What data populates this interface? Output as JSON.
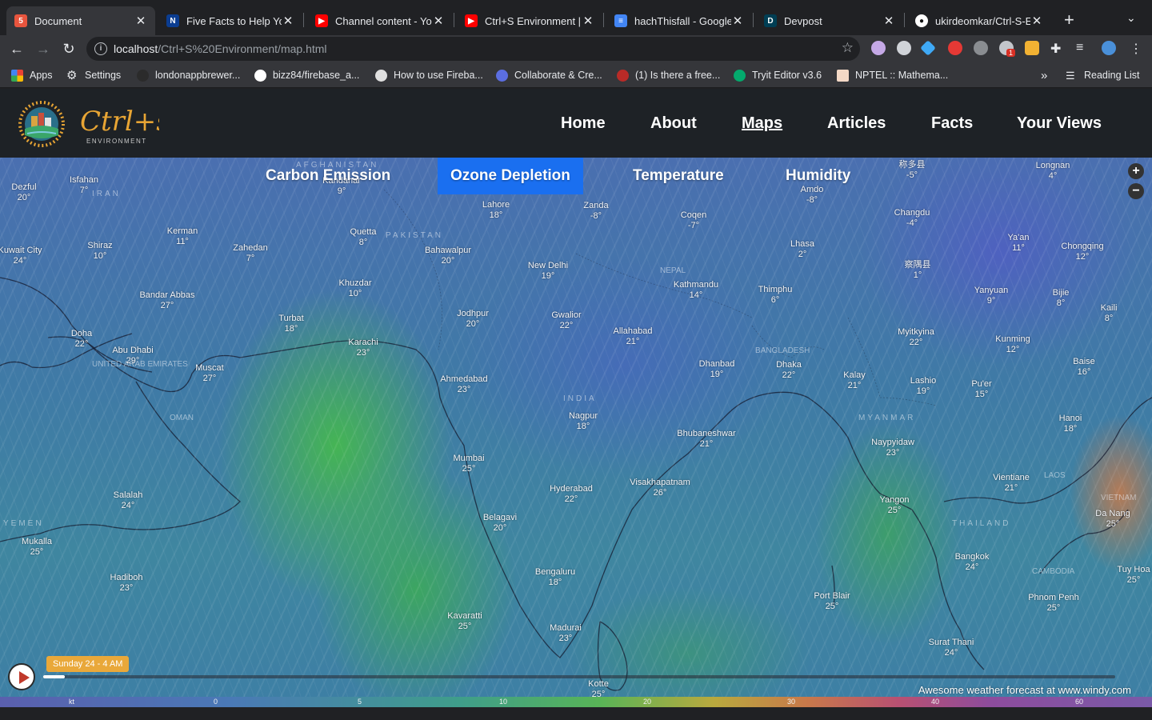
{
  "browser": {
    "tabs": [
      {
        "title": "Document",
        "active": true
      },
      {
        "title": "Five Facts to Help You",
        "active": false
      },
      {
        "title": "Channel content - YouTube",
        "active": false
      },
      {
        "title": "Ctrl+S Environment | YouTube",
        "active": false
      },
      {
        "title": "hachThisfall - Google Docs",
        "active": false
      },
      {
        "title": "Devpost",
        "active": false
      },
      {
        "title": "ukirdeomkar/Ctrl-S-Environment",
        "active": false
      }
    ],
    "new_tab": "+",
    "url_host": "localhost",
    "url_path": "/Ctrl+S%20Environment/map.html",
    "bookmarks": [
      {
        "label": "Apps"
      },
      {
        "label": "Settings"
      },
      {
        "label": "londonappbrewer..."
      },
      {
        "label": "bizz84/firebase_a..."
      },
      {
        "label": "How to use Fireba..."
      },
      {
        "label": "Collaborate & Cre..."
      },
      {
        "label": "(1) Is there a free..."
      },
      {
        "label": "Tryit Editor v3.6"
      },
      {
        "label": "NPTEL :: Mathema..."
      }
    ],
    "more_bookmarks": "»",
    "reading_list": "Reading List",
    "extension_badge": "1"
  },
  "site": {
    "logo_text": "Ctrl+s",
    "logo_subtext": "ENVIRONMENT",
    "nav": [
      "Home",
      "About",
      "Maps",
      "Articles",
      "Facts",
      "Your Views"
    ],
    "active_nav": "Maps"
  },
  "map": {
    "layers": [
      "Carbon Emission",
      "Ozone Depletion",
      "Temperature",
      "Humidity"
    ],
    "active_layer": "Ozone Depletion",
    "zoom_in": "+",
    "zoom_out": "−",
    "time_label": "Sunday 24 - 4 AM",
    "progress": 0.02,
    "credit_text": "Awesome weather forecast at ",
    "credit_link": "www.windy.com",
    "scale_unit": "kt",
    "scale_ticks": [
      "0",
      "5",
      "10",
      "20",
      "30",
      "40",
      "60"
    ],
    "countries": [
      "AFGHANISTAN",
      "IRAN",
      "PAKISTAN",
      "NEPAL",
      "BANGLADESH",
      "INDIA",
      "MYANMAR",
      "UNITED ARAB EMIRATES",
      "OMAN",
      "YEMEN",
      "THAILAND",
      "LAOS",
      "CAMBODIA",
      "VIETNAM"
    ],
    "cities": [
      {
        "name": "Dezful",
        "temp": "20°"
      },
      {
        "name": "Isfahan",
        "temp": "7°"
      },
      {
        "name": "Kerman",
        "temp": "11°"
      },
      {
        "name": "Shiraz",
        "temp": "10°"
      },
      {
        "name": "Kuwait City",
        "temp": "24°"
      },
      {
        "name": "Zahedan",
        "temp": "7°"
      },
      {
        "name": "Quetta",
        "temp": "8°"
      },
      {
        "name": "Kandahar",
        "temp": "9°"
      },
      {
        "name": "Lahore",
        "temp": "18°"
      },
      {
        "name": "Zanda",
        "temp": "-8°"
      },
      {
        "name": "Coqen",
        "temp": "-7°"
      },
      {
        "name": "Amdo",
        "temp": "-8°"
      },
      {
        "name": "Changdu",
        "temp": "-4°"
      },
      {
        "name": "Longnan",
        "temp": "4°"
      },
      {
        "name": "称多县",
        "temp": "-5°"
      },
      {
        "name": "Bahawalpur",
        "temp": "20°"
      },
      {
        "name": "New Delhi",
        "temp": "19°"
      },
      {
        "name": "Lhasa",
        "temp": "2°"
      },
      {
        "name": "Ya'an",
        "temp": "11°"
      },
      {
        "name": "Chongqing",
        "temp": "12°"
      },
      {
        "name": "察隅县",
        "temp": "1°"
      },
      {
        "name": "Bandar Abbas",
        "temp": "27°"
      },
      {
        "name": "Khuzdar",
        "temp": "10°"
      },
      {
        "name": "Kathmandu",
        "temp": "14°"
      },
      {
        "name": "Thimphu",
        "temp": "6°"
      },
      {
        "name": "Yanyuan",
        "temp": "9°"
      },
      {
        "name": "Bijie",
        "temp": "8°"
      },
      {
        "name": "Kaili",
        "temp": "8°"
      },
      {
        "name": "Jodhpur",
        "temp": "20°"
      },
      {
        "name": "Gwalior",
        "temp": "22°"
      },
      {
        "name": "Turbat",
        "temp": "18°"
      },
      {
        "name": "Doha",
        "temp": "22°"
      },
      {
        "name": "Allahabad",
        "temp": "21°"
      },
      {
        "name": "Myitkyina",
        "temp": "22°"
      },
      {
        "name": "Kunming",
        "temp": "12°"
      },
      {
        "name": "Karachi",
        "temp": "23°"
      },
      {
        "name": "Abu Dhabi",
        "temp": "29°"
      },
      {
        "name": "Muscat",
        "temp": "27°"
      },
      {
        "name": "Dhanbad",
        "temp": "19°"
      },
      {
        "name": "Dhaka",
        "temp": "22°"
      },
      {
        "name": "Baise",
        "temp": "16°"
      },
      {
        "name": "Ahmedabad",
        "temp": "23°"
      },
      {
        "name": "Kalay",
        "temp": "21°"
      },
      {
        "name": "Lashio",
        "temp": "19°"
      },
      {
        "name": "Pu'er",
        "temp": "15°"
      },
      {
        "name": "Nagpur",
        "temp": "18°"
      },
      {
        "name": "Hanoi",
        "temp": "18°"
      },
      {
        "name": "Bhubaneshwar",
        "temp": "21°"
      },
      {
        "name": "Naypyidaw",
        "temp": "23°"
      },
      {
        "name": "Mumbai",
        "temp": "25°"
      },
      {
        "name": "Salalah",
        "temp": "24°"
      },
      {
        "name": "Hyderabad",
        "temp": "22°"
      },
      {
        "name": "Visakhapatnam",
        "temp": "26°"
      },
      {
        "name": "Vientiane",
        "temp": "21°"
      },
      {
        "name": "Yangon",
        "temp": "25°"
      },
      {
        "name": "Belagavi",
        "temp": "20°"
      },
      {
        "name": "Da Nang",
        "temp": "25°"
      },
      {
        "name": "Mukalla",
        "temp": "25°"
      },
      {
        "name": "Bangkok",
        "temp": "24°"
      },
      {
        "name": "Bengaluru",
        "temp": "18°"
      },
      {
        "name": "Hadiboh",
        "temp": "23°"
      },
      {
        "name": "Tuy Hoa",
        "temp": "25°"
      },
      {
        "name": "Port Blair",
        "temp": "25°"
      },
      {
        "name": "Phnom Penh",
        "temp": "25°"
      },
      {
        "name": "Kavaratti",
        "temp": "25°"
      },
      {
        "name": "Madurai",
        "temp": "23°"
      },
      {
        "name": "Surat Thani",
        "temp": "24°"
      },
      {
        "name": "Kotte",
        "temp": "25°"
      }
    ]
  }
}
